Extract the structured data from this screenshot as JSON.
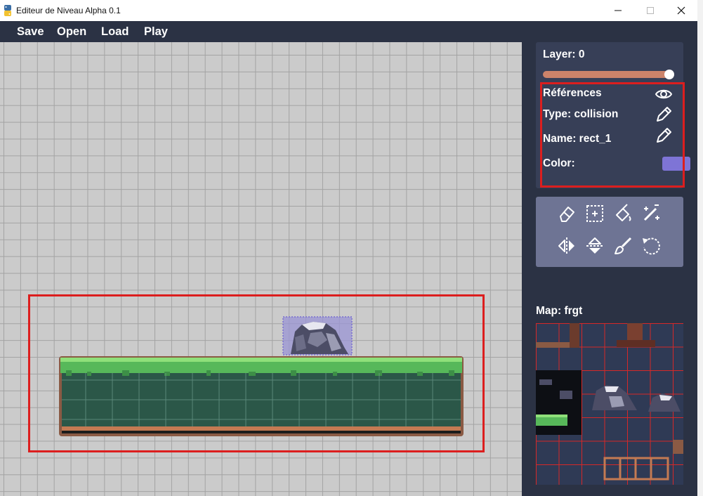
{
  "window": {
    "title": "Editeur de Niveau Alpha 0.1",
    "controls": [
      "minimize-icon",
      "maximize-icon",
      "close-icon"
    ]
  },
  "menu": {
    "save": "Save",
    "open": "Open",
    "load": "Load",
    "play": "Play"
  },
  "layer_panel": {
    "layer_label": "Layer: 0",
    "slider_value": 1.0,
    "references_label": "Références",
    "type_label": "Type: collision",
    "name_label": "Name: rect_1",
    "color_label": "Color:",
    "color_value": "#7e74d6"
  },
  "tools": [
    "eraser-icon",
    "select-rect-icon",
    "fill-bucket-icon",
    "magic-wand-icon",
    "flip-horizontal-icon",
    "flip-vertical-icon",
    "brush-icon",
    "rotate-icon"
  ],
  "map": {
    "label": "Map: frgt"
  },
  "colors": {
    "background": "#2b3244",
    "panel": "#373f57",
    "tools_panel": "#6e7494",
    "highlight_frame": "#dc1e1e",
    "slider": "#cc836a",
    "grid_canvas": "#cbcbcb"
  }
}
